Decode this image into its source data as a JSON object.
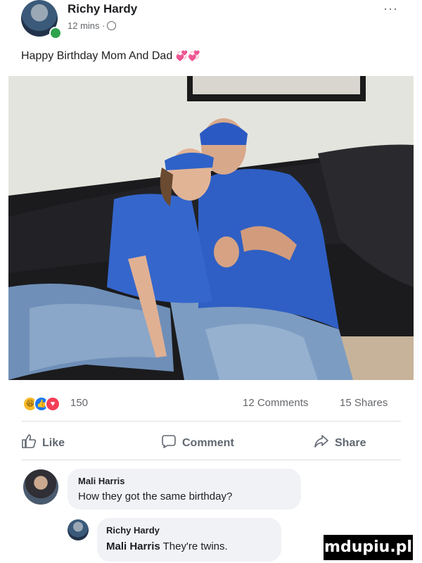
{
  "post": {
    "author": "Richy Hardy",
    "time": "12 mins ·",
    "more": "···",
    "text": "Happy Birthday Mom And Dad",
    "text_emojis": "💞💞"
  },
  "reactions": {
    "icons": [
      "haha-icon",
      "like-icon",
      "love-icon"
    ],
    "icon_glyphs": [
      "😆",
      "👍",
      "♥"
    ],
    "count": "150",
    "comments": "12 Comments",
    "shares": "15 Shares"
  },
  "actions": {
    "like": "Like",
    "comment": "Comment",
    "share": "Share"
  },
  "comments": [
    {
      "author": "Mali Harris",
      "text": "How they got the same birthday?"
    },
    {
      "author": "Richy Hardy",
      "mention": "Mali Harris",
      "text": "They're twins."
    }
  ],
  "watermark": "mdupiu.pl",
  "colors": {
    "link_blue": "#1877f2",
    "secondary_text": "#65676b",
    "bubble": "#f0f2f5",
    "shirt_blue": "#2f5fc4"
  }
}
